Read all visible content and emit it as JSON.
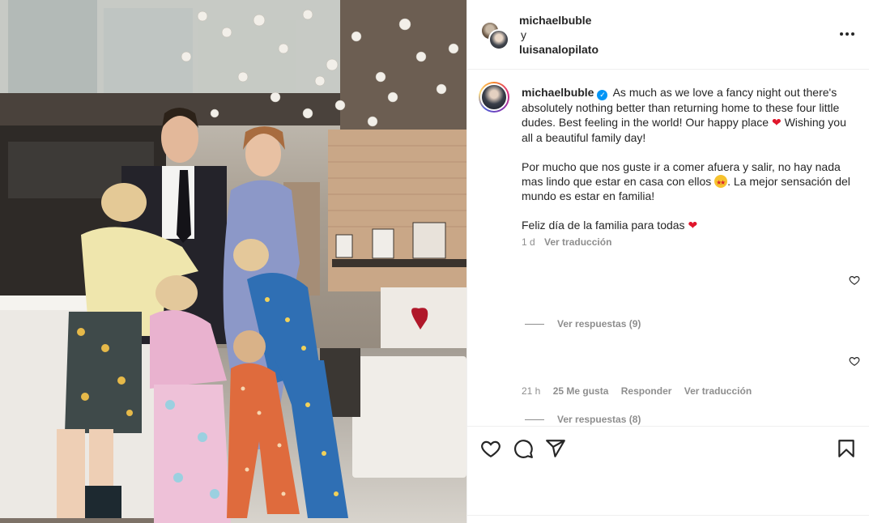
{
  "photo": {
    "alt_icon": "photo-family"
  },
  "header": {
    "user1": "michaelbuble",
    "conjunction": "y",
    "user2": "luisanalopilato",
    "more_icon": "more-horizontal-icon"
  },
  "caption": {
    "author": "michaelbuble",
    "verified_icon": "verified-badge-icon",
    "para1_a": "As much as we love a fancy night out there's absolutely nothing better than returning home to these four little dudes. Best feeling in the world! Our happy place",
    "para1_emoji": "❤",
    "para1_b": "Wishing you all a beautiful family day!",
    "para2_a": "Por mucho que nos guste ir a comer afuera y salir, no hay nada mas lindo que estar en casa con ellos",
    "para2_b": ". La mejor sensación del mundo es estar en familia!",
    "para3": "Feliz día de la familia para todas",
    "para3_emoji": "❤",
    "time": "1 d",
    "translate": "Ver traducción"
  },
  "comments": {
    "replies1": "Ver respuestas (9)",
    "time2": "21 h",
    "likes2": "25 Me gusta",
    "reply2": "Responder",
    "translate2": "Ver traducción",
    "replies2": "Ver respuestas (8)"
  },
  "actions": {
    "like_icon": "heart-icon",
    "comment_icon": "comment-icon",
    "share_icon": "send-icon",
    "save_icon": "bookmark-icon"
  },
  "colors": {
    "text": "#262626",
    "muted": "#8e8e8e",
    "verified": "#0095f6",
    "heart": "#e0162b",
    "border": "#efefef"
  }
}
